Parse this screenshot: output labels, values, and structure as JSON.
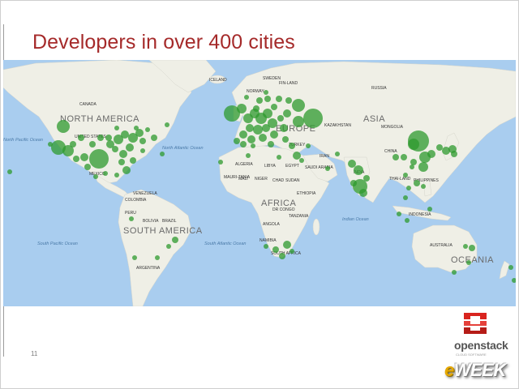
{
  "slide": {
    "title": "Developers in over 400 cities",
    "page_number": "11"
  },
  "map": {
    "continents": [
      "NORTH AMERICA",
      "SOUTH AMERICA",
      "ASIA",
      "AFRICA",
      "OCEANIA",
      "EUROPE"
    ],
    "countries": [
      "CANADA",
      "ICELAND",
      "SWEDEN",
      "FIN-LAND",
      "NORWAY",
      "RUSSIA",
      "KAZAKHSTAN",
      "MONGOLIA",
      "CHINA",
      "TURKEY",
      "IRAN",
      "INDIA",
      "ALGERIA",
      "LIBYA",
      "EGYPT",
      "MALI",
      "NIGER",
      "MAURI-TANIA",
      "CHAD",
      "SUDAN",
      "SAUDI ARABIA",
      "ETHIOPIA",
      "DR CONGO",
      "TANZANIA",
      "ANGOLA",
      "NAMIBIA",
      "SOUTH AFRICA",
      "VENEZUELA",
      "COLOMBIA",
      "PERU",
      "BRAZIL",
      "BOLIVIA",
      "ARGENTINA",
      "MEXICO",
      "UNITED STATES",
      "THAI-LAND",
      "PHILIPPINES",
      "INDONESIA",
      "AUSTRALIA"
    ],
    "oceans": [
      "North Atlantic Ocean",
      "South Atlantic Ocean",
      "South Pacific Ocean",
      "Indian Ocean",
      "North Pacific Ocean"
    ],
    "land_color": "#efefe6",
    "water_color": "#a9cdef",
    "marker_color": "#2e9a2e"
  },
  "logo": {
    "name": "openstack",
    "tagline": "CLOUD SOFTWARE",
    "icon": "openstack-logo-icon",
    "color": "#d9241f"
  },
  "watermark": {
    "e": "e",
    "rest": "WEEK"
  }
}
